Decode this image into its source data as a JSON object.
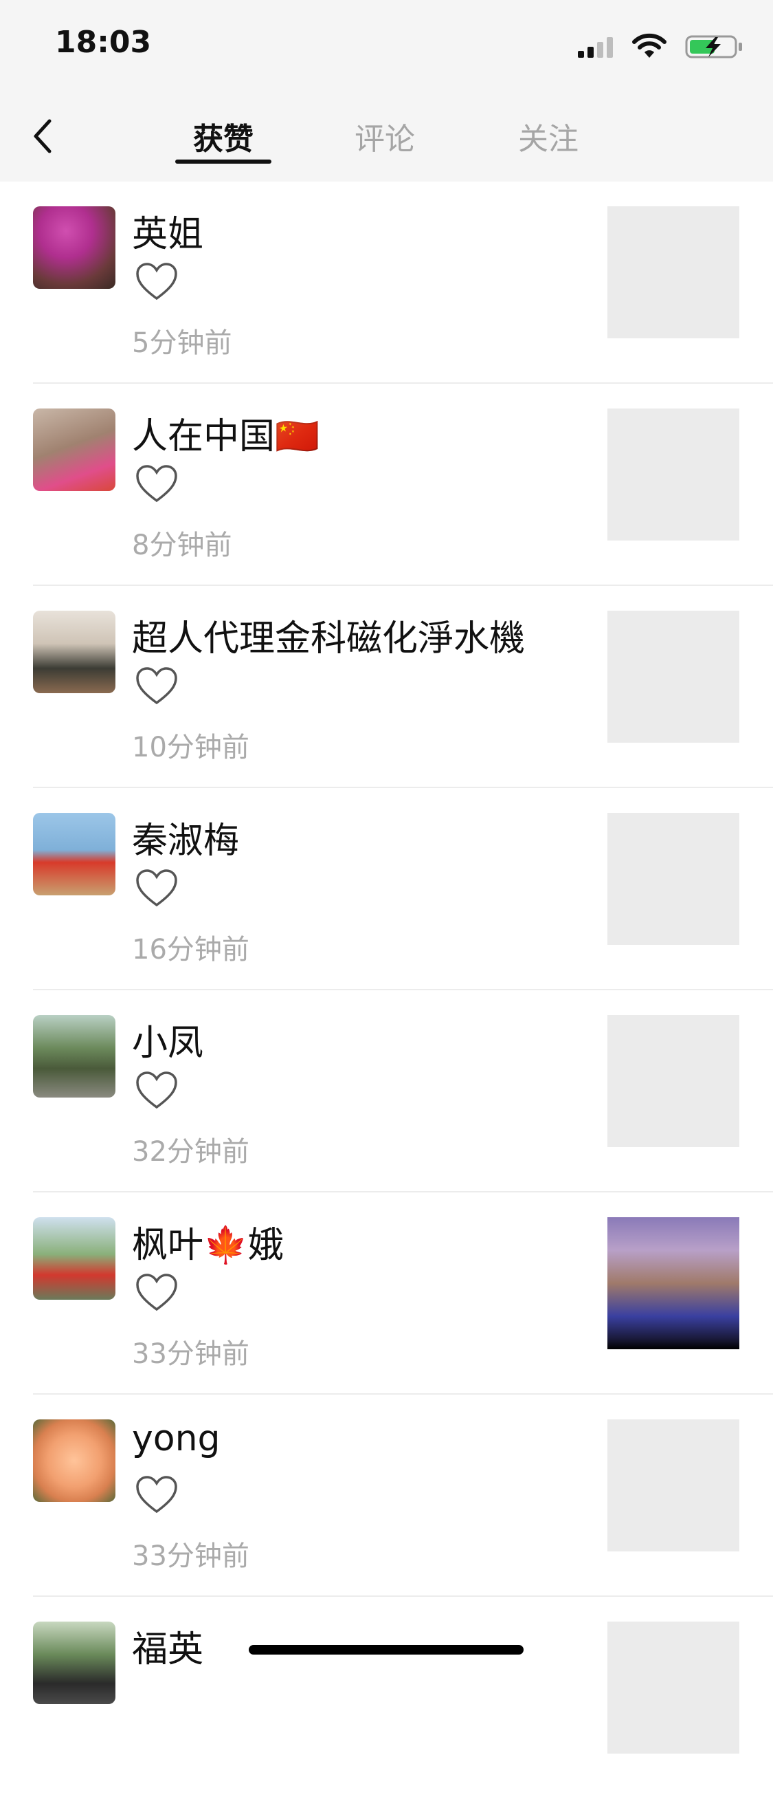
{
  "status_bar": {
    "time": "18:03"
  },
  "tabs": [
    {
      "label": "获赞",
      "active": true
    },
    {
      "label": "评论",
      "active": false
    },
    {
      "label": "关注",
      "active": false
    }
  ],
  "items": [
    {
      "name": "英姐",
      "time": "5分钟前",
      "has_thumb": false
    },
    {
      "name": "人在中国🇨🇳",
      "time": "8分钟前",
      "has_thumb": false
    },
    {
      "name": "超人代理金科磁化淨水機",
      "time": "10分钟前",
      "has_thumb": false
    },
    {
      "name": "秦淑梅",
      "time": "16分钟前",
      "has_thumb": false
    },
    {
      "name": "小凤",
      "time": "32分钟前",
      "has_thumb": false
    },
    {
      "name": "枫叶🍁娥",
      "time": "33分钟前",
      "has_thumb": true
    },
    {
      "name": "yong",
      "time": "33分钟前",
      "has_thumb": false
    },
    {
      "name": "福英",
      "time": "",
      "has_thumb": false
    }
  ],
  "colors": {
    "header_bg": "#f5f5f5",
    "divider": "#ececec",
    "placeholder": "#ebebeb",
    "muted_text": "#aaaaaa"
  }
}
